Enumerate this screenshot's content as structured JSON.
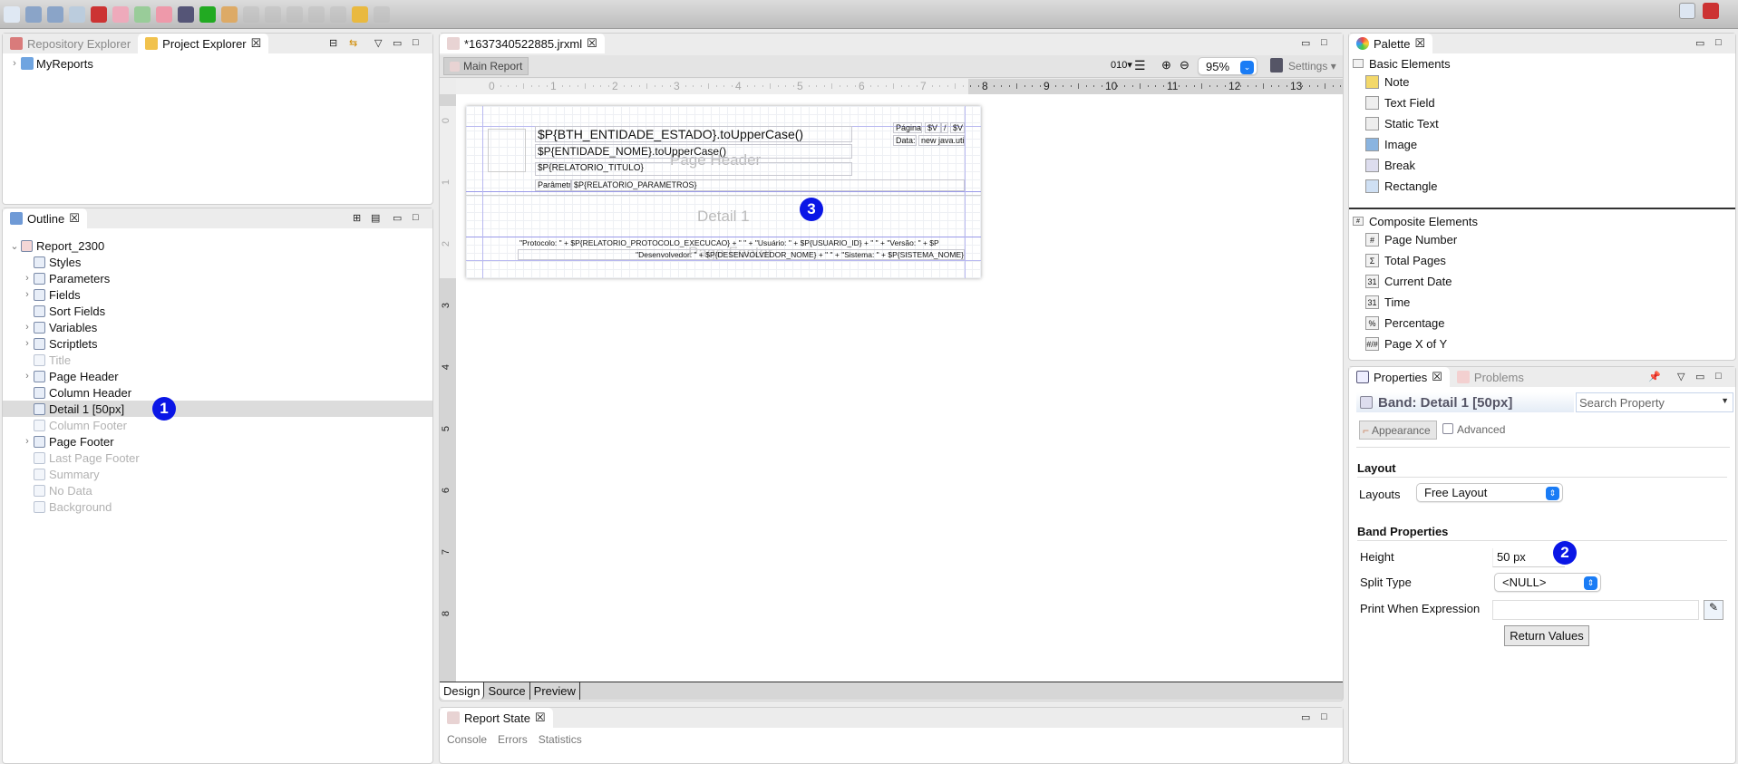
{
  "toolbar": {
    "icons": [
      "new-icon",
      "save-icon",
      "save-all-icon",
      "compile-icon",
      "debug-icon",
      "new-report-icon",
      "new-dataset-icon",
      "edit-icon",
      "publish-icon",
      "run-icon",
      "tools-icon",
      "step-icon",
      "step-up-icon",
      "back-icon",
      "back2-icon",
      "forward-icon",
      "undo-icon",
      "redo-icon"
    ]
  },
  "left_top": {
    "tabs": [
      {
        "label": "Repository Explorer"
      },
      {
        "label": "Project Explorer"
      }
    ],
    "tree": [
      {
        "label": "MyReports"
      }
    ]
  },
  "outline": {
    "title": "Outline",
    "root": "Report_2300",
    "items": [
      {
        "label": "Styles",
        "expandable": false,
        "dim": false
      },
      {
        "label": "Parameters",
        "expandable": true,
        "dim": false
      },
      {
        "label": "Fields",
        "expandable": true,
        "dim": false
      },
      {
        "label": "Sort Fields",
        "expandable": false,
        "dim": false
      },
      {
        "label": "Variables",
        "expandable": true,
        "dim": false
      },
      {
        "label": "Scriptlets",
        "expandable": true,
        "dim": false
      },
      {
        "label": "Title",
        "expandable": false,
        "dim": true
      },
      {
        "label": "Page Header",
        "expandable": true,
        "dim": false
      },
      {
        "label": "Column Header",
        "expandable": false,
        "dim": false
      },
      {
        "label": "Detail 1 [50px]",
        "expandable": false,
        "dim": false,
        "selected": true
      },
      {
        "label": "Column Footer",
        "expandable": false,
        "dim": true
      },
      {
        "label": "Page Footer",
        "expandable": true,
        "dim": false
      },
      {
        "label": "Last Page Footer",
        "expandable": false,
        "dim": true
      },
      {
        "label": "Summary",
        "expandable": false,
        "dim": true
      },
      {
        "label": "No Data",
        "expandable": false,
        "dim": true
      },
      {
        "label": "Background",
        "expandable": false,
        "dim": true
      }
    ]
  },
  "badges": {
    "one": "1",
    "two": "2",
    "three": "3"
  },
  "editor": {
    "tab": "*1637340522885.jrxml",
    "main_report": "Main Report",
    "zoom": "95%",
    "settings": "Settings",
    "ruler_h": [
      "0",
      "1",
      "2",
      "3",
      "4",
      "5",
      "6",
      "7",
      "8",
      "9",
      "10",
      "11",
      "12",
      "13"
    ],
    "ruler_v": [
      "0",
      "1",
      "2",
      "3",
      "4",
      "5",
      "6",
      "7",
      "8"
    ],
    "bands": {
      "page_header": "Page Header",
      "detail": "Detail 1",
      "page_footer": "Page Footer"
    },
    "fields": {
      "estado": "$P{BTH_ENTIDADE_ESTADO}.toUpperCase()",
      "nome": "$P{ENTIDADE_NOME}.toUpperCase()",
      "titulo": "$P{RELATORIO_TITULO}",
      "param_label": "Parâmetros:",
      "param_value": "$P{RELATORIO_PARAMETROS}",
      "pagina_label": "Página:",
      "pagina_v1": "$V",
      "pagina_sep": "/",
      "pagina_v2": "$V",
      "data_label": "Data:",
      "data_value": "new java.util.",
      "footer1": "\"Protocolo: \" + $P{RELATORIO_PROTOCOLO_EXECUCAO} + \"   \" + \"Usuário: \" + $P{USUARIO_ID} + \"    \" + \"Versão: \" + $P",
      "footer2": "\"Desenvolvedor: \" + $P{DESENVOLVEDOR_NOME} + \"    \" + \"Sistema: \" + $P{SISTEMA_NOME}"
    },
    "bottom_tabs": [
      "Design",
      "Source",
      "Preview"
    ]
  },
  "report_state": {
    "title": "Report State",
    "tabs": [
      "Console",
      "Errors",
      "Statistics"
    ]
  },
  "palette": {
    "title": "Palette",
    "basic": "Basic Elements",
    "basic_items": [
      "Note",
      "Text Field",
      "Static Text",
      "Image",
      "Break",
      "Rectangle"
    ],
    "composite": "Composite Elements",
    "composite_items": [
      {
        "label": "Page Number",
        "glyph": "#"
      },
      {
        "label": "Total Pages",
        "glyph": "Σ"
      },
      {
        "label": "Current Date",
        "glyph": "31"
      },
      {
        "label": "Time",
        "glyph": "31"
      },
      {
        "label": "Percentage",
        "glyph": "%"
      },
      {
        "label": "Page X of Y",
        "glyph": "#/#"
      }
    ]
  },
  "properties": {
    "tabs": [
      "Properties",
      "Problems"
    ],
    "band_title": "Band: Detail 1 [50px]",
    "search_placeholder": "Search Property",
    "subtabs": [
      "Appearance",
      "Advanced"
    ],
    "layout_section": "Layout",
    "layouts_label": "Layouts",
    "layouts_value": "Free Layout",
    "band_section": "Band Properties",
    "height_label": "Height",
    "height_value": "50 px",
    "split_label": "Split Type",
    "split_value": "<NULL>",
    "print_label": "Print When Expression",
    "print_value": "",
    "return_values": "Return Values"
  }
}
